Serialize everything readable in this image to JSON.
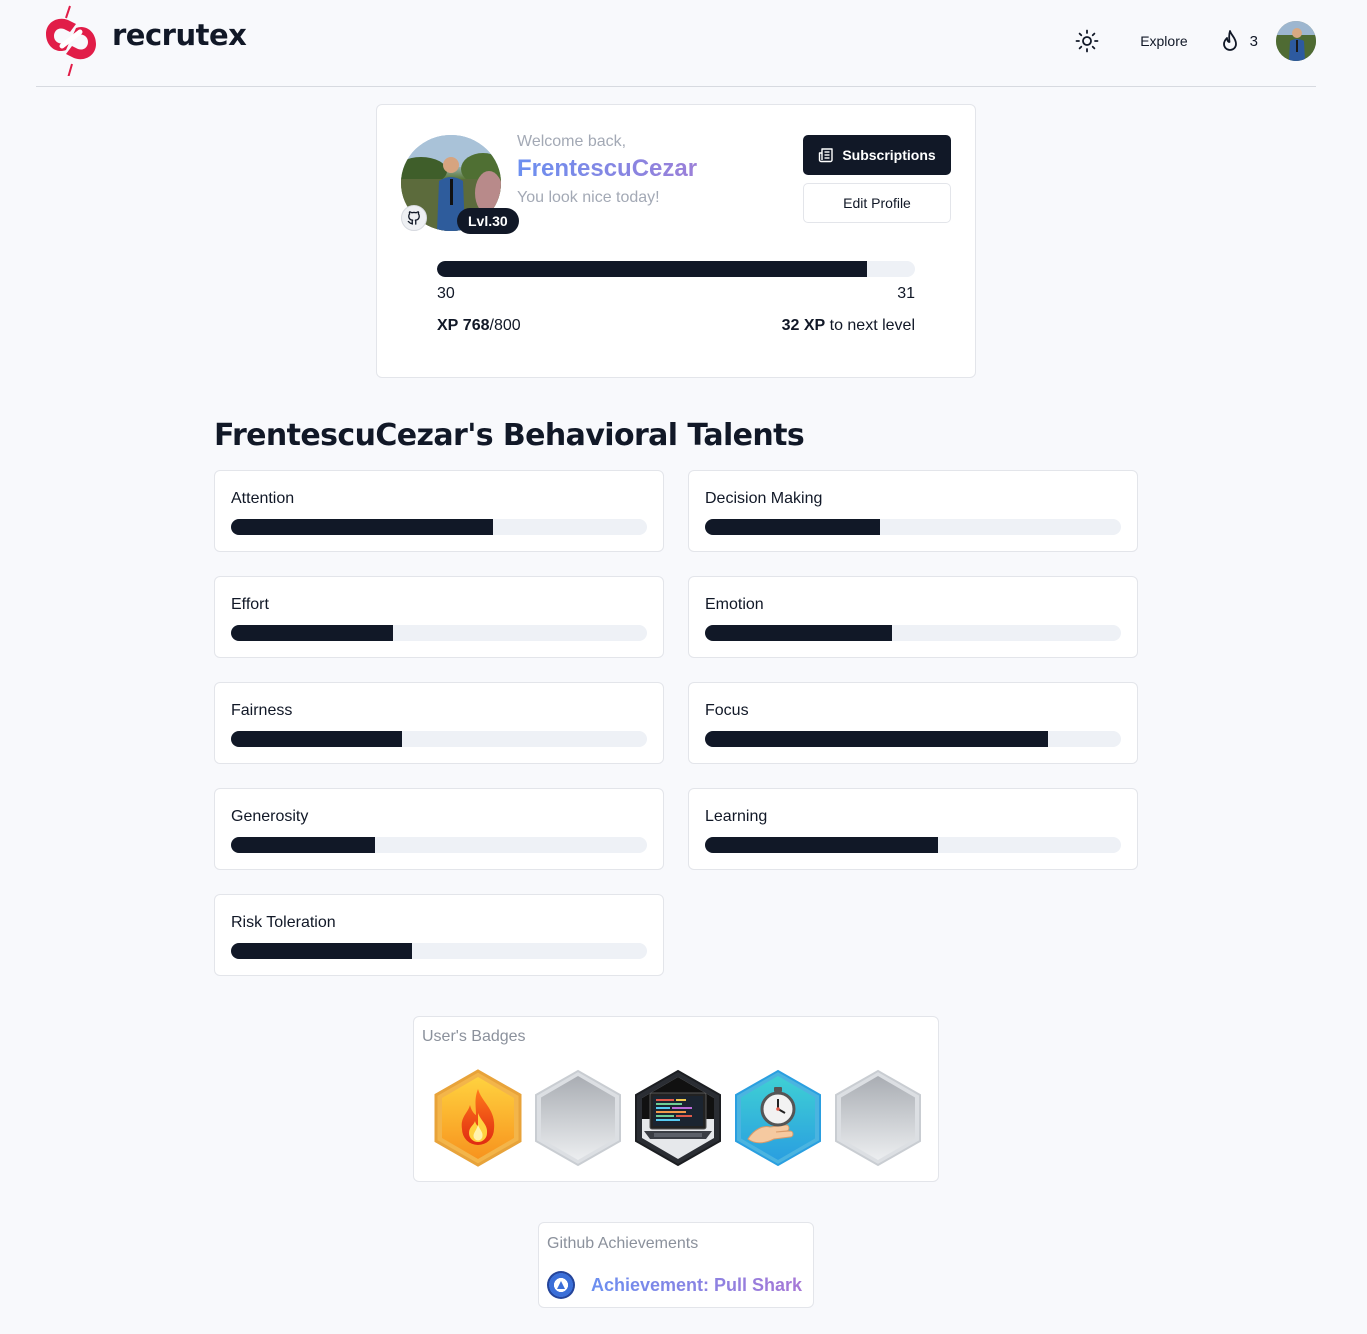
{
  "app": {
    "brand": "recrutex"
  },
  "nav": {
    "explore_label": "Explore",
    "streak_count": "3",
    "theme_icon": "sun-icon",
    "streak_icon": "flame-icon"
  },
  "profile": {
    "welcome": "Welcome back,",
    "username": "FrentescuCezar",
    "compliment": "You look nice today!",
    "level_badge": "Lvl.30",
    "subscriptions_label": "Subscriptions",
    "edit_profile_label": "Edit Profile",
    "level_from": "30",
    "level_to": "31",
    "xp_prefix": "XP",
    "xp_current": "768",
    "xp_max": "/800",
    "xp_fraction": 0.9,
    "xp_to_next_amount": "32 XP",
    "xp_to_next_suffix": " to next level"
  },
  "talents": {
    "title": "FrentescuCezar's Behavioral Talents",
    "items": [
      {
        "name": "Attention",
        "value": 0.63
      },
      {
        "name": "Decision Making",
        "value": 0.42
      },
      {
        "name": "Effort",
        "value": 0.39
      },
      {
        "name": "Emotion",
        "value": 0.45
      },
      {
        "name": "Fairness",
        "value": 0.41
      },
      {
        "name": "Focus",
        "value": 0.825
      },
      {
        "name": "Generosity",
        "value": 0.345
      },
      {
        "name": "Learning",
        "value": 0.56
      },
      {
        "name": "Risk Toleration",
        "value": 0.435
      }
    ]
  },
  "badges": {
    "title": "User's Badges",
    "items": [
      "fire-badge",
      "locked-badge",
      "laptop-code-badge",
      "stopwatch-badge",
      "locked-badge"
    ]
  },
  "github": {
    "title": "Github Achievements",
    "achievement": "Achievement: Pull Shark",
    "achievement_icon": "pull-shark-icon"
  },
  "colors": {
    "primary": "#111827",
    "track": "#eef1f6",
    "accent_gradient_start": "#6b8ff0",
    "accent_gradient_end": "#a678d6",
    "brand_red": "#e11d48"
  }
}
